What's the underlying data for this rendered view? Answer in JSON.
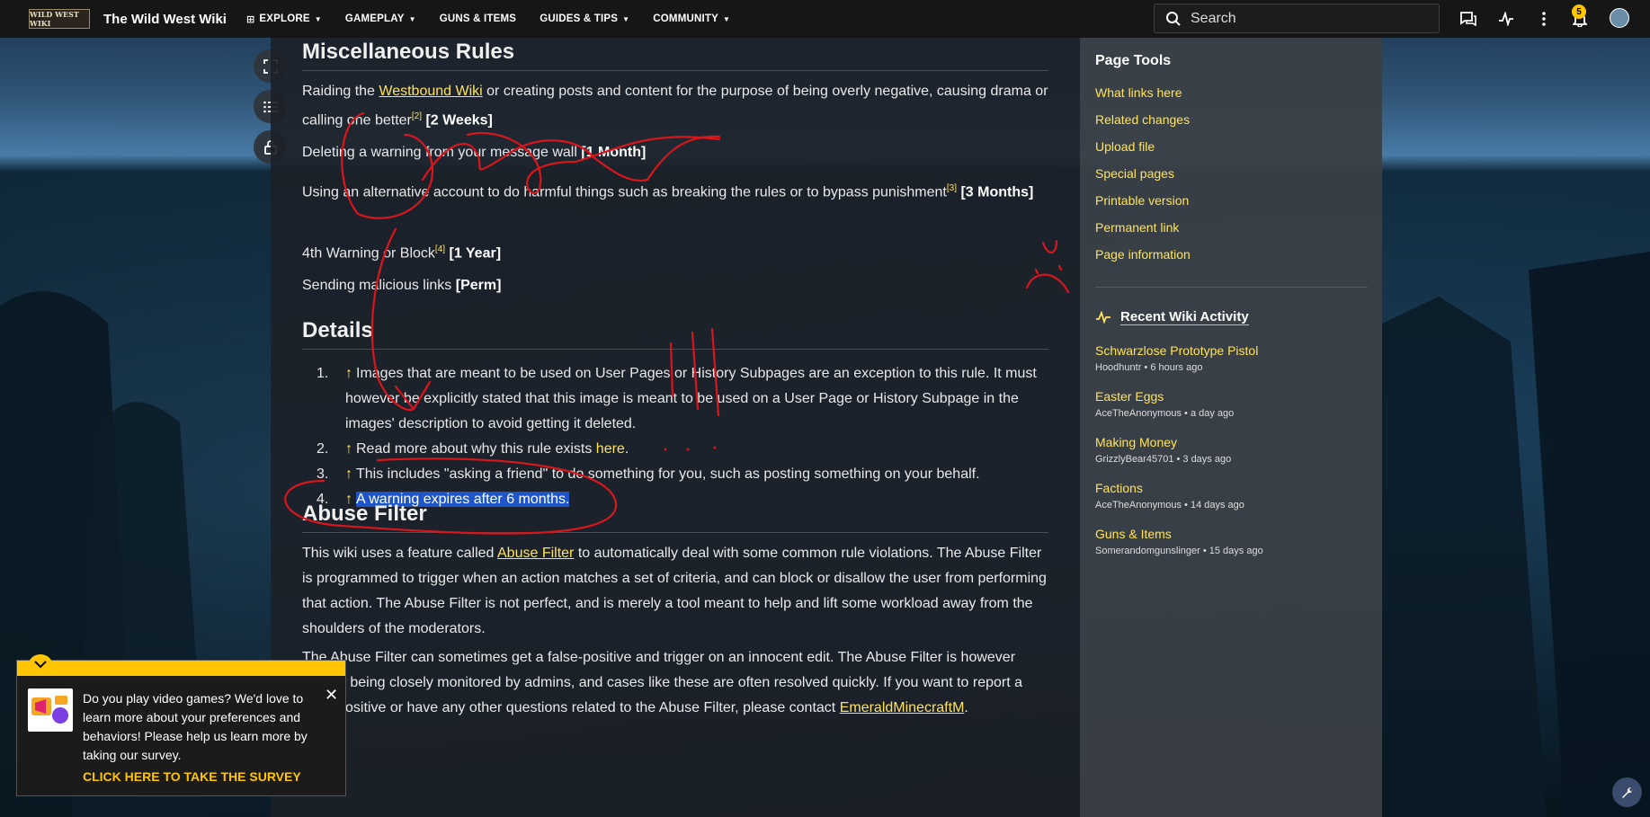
{
  "nav": {
    "logo_text": "WILD WEST WIKI",
    "site_title": "The Wild West Wiki",
    "items": [
      {
        "label": "EXPLORE"
      },
      {
        "label": "GAMEPLAY"
      },
      {
        "label": "GUNS & ITEMS"
      },
      {
        "label": "GUIDES & TIPS"
      },
      {
        "label": "COMMUNITY"
      }
    ],
    "search_placeholder": "Search",
    "notification_count": "5"
  },
  "article": {
    "misc_heading": "Miscellaneous Rules",
    "rules": {
      "raid_pre": "Raiding the ",
      "raid_link": "Westbound Wiki",
      "raid_post": " or creating posts and content for the purpose of being overly negative, causing drama or calling one better",
      "raid_ref": "[2]",
      "raid_penalty": "[2 Weeks]",
      "delete_text": "Deleting a warning from your message wall ",
      "delete_penalty": "[1 Month]",
      "alt_text": "Using an alternative account to do harmful things such as breaking the rules or to bypass punishment",
      "alt_ref": "[3]",
      "alt_penalty": "[3 Months]",
      "fourth_text": "4th Warning or Block",
      "fourth_ref": "[4]",
      "fourth_penalty": "[1 Year]",
      "links_text": "Sending malicious links ",
      "links_penalty": "[Perm]"
    },
    "details_heading": "Details",
    "details": [
      {
        "num": "1.",
        "arrow": "↑",
        "text": "Images that are meant to be used on User Pages or History Subpages are an exception to this rule. It must however be explicitly stated that this image is meant to be used on a User Page or History Subpage in the images' description to avoid getting it deleted."
      },
      {
        "num": "2.",
        "arrow": "↑",
        "text": "Read more about why this rule exists ",
        "link": "here",
        "tail": "."
      },
      {
        "num": "3.",
        "arrow": "↑",
        "text": "This includes \"asking a friend\" to do something for you, such as posting something on your behalf."
      },
      {
        "num": "4.",
        "arrow": "↑",
        "text": "A warning expires after 6 months."
      }
    ],
    "abuse_heading": "Abuse Filter",
    "abuse_p1_pre": "This wiki uses a feature called ",
    "abuse_p1_link": "Abuse Filter",
    "abuse_p1_post": " to automatically deal with some common rule violations. The Abuse Filter is programmed to trigger when an action matches a set of criteria, and can block or disallow the user from performing that action. The Abuse Filter is not perfect, and is merely a tool meant to help and lift some workload away from the shoulders of the moderators.",
    "abuse_p2_pre": "The Abuse Filter can sometimes get a false-positive and trigger on an innocent edit. The Abuse Filter is however always being closely monitored by admins, and cases like these are often resolved quickly. If you want to report a false-positive or have any other questions related to the Abuse Filter, please contact ",
    "abuse_p2_link": "EmeraldMinecraftM",
    "abuse_p2_tail": "."
  },
  "rail": {
    "tools_title": "Page Tools",
    "tools": [
      "What links here",
      "Related changes",
      "Upload file",
      "Special pages",
      "Printable version",
      "Permanent link",
      "Page information"
    ],
    "activity_title": "Recent Wiki Activity",
    "activity": [
      {
        "title": "Schwarzlose Prototype Pistol",
        "meta": "Hoodhuntr • 6 hours ago"
      },
      {
        "title": "Easter Eggs",
        "meta": "AceTheAnonymous • a day ago"
      },
      {
        "title": "Making Money",
        "meta": "GrizzlyBear45701 • 3 days ago"
      },
      {
        "title": "Factions",
        "meta": "AceTheAnonymous • 14 days ago"
      },
      {
        "title": "Guns & Items",
        "meta": "Somerandomgunslinger • 15 days ago"
      }
    ]
  },
  "survey": {
    "text": "Do you play video games? We'd love to learn more about your preferences and behaviors! Please help us learn more by taking our survey.",
    "cta": "CLICK HERE TO TAKE THE SURVEY"
  },
  "colors": {
    "accent_link": "#ffe35a",
    "survey_yellow": "#ffc500",
    "annotation_red": "#d9161b",
    "selection_blue": "#1e56c9"
  }
}
